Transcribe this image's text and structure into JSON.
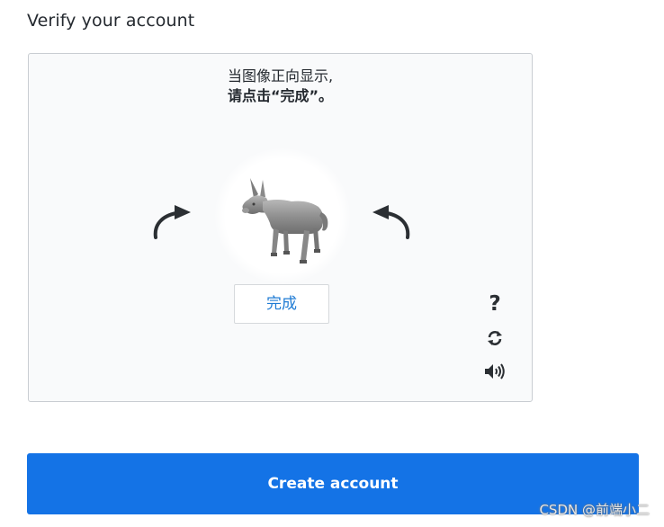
{
  "page": {
    "title": "Verify your account"
  },
  "captcha": {
    "instruction_line1": "当图像正向显示,",
    "instruction_line2": "请点击“完成”。",
    "rotate_left_icon": "rotate-left-arrow-icon",
    "rotate_right_icon": "rotate-right-arrow-icon",
    "image_subject": "donkey",
    "done_label": "完成",
    "tools": {
      "help_icon": "question-mark-icon",
      "help_glyph": "?",
      "refresh_icon": "refresh-icon",
      "audio_icon": "speaker-icon"
    }
  },
  "actions": {
    "create_account_label": "Create account"
  },
  "watermark": {
    "text": "CSDN @前端小二"
  },
  "colors": {
    "accent": "#1473e6",
    "link_blue": "#1f7bd4",
    "frame_bg": "#f9fafb",
    "frame_border": "#c9cdd2"
  }
}
